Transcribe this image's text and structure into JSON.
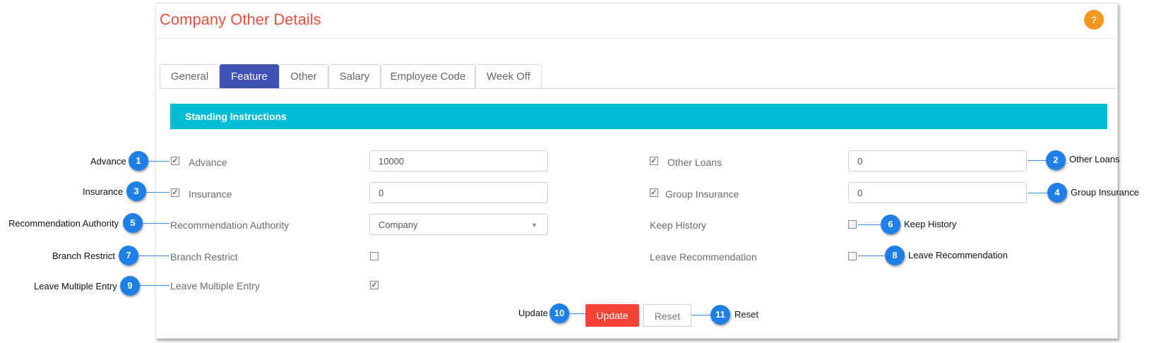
{
  "header": {
    "title": "Company Other Details",
    "help_label": "?"
  },
  "tabs": [
    "General",
    "Feature",
    "Other",
    "Salary",
    "Employee Code",
    "Week Off"
  ],
  "active_tab": "Feature",
  "section": {
    "title": "Standing Instructions"
  },
  "fields": {
    "advance": {
      "label": "Advance",
      "checked": true,
      "value": "10000"
    },
    "other_loans": {
      "label": "Other Loans",
      "checked": true,
      "value": "0"
    },
    "insurance": {
      "label": "Insurance",
      "checked": true,
      "value": "0"
    },
    "group_insurance": {
      "label": "Group Insurance",
      "checked": true,
      "value": "0"
    },
    "recommendation_authority": {
      "label": "Recommendation Authority",
      "value": "Company"
    },
    "keep_history": {
      "label": "Keep History",
      "checked": false
    },
    "branch_restrict": {
      "label": "Branch Restrict",
      "checked": false
    },
    "leave_recommendation": {
      "label": "Leave Recommendation",
      "checked": false
    },
    "leave_multiple_entry": {
      "label": "Leave Multiple Entry",
      "checked": true
    }
  },
  "actions": {
    "update": "Update",
    "reset": "Reset"
  },
  "callouts": [
    {
      "num": "1",
      "label": "Advance"
    },
    {
      "num": "2",
      "label": "Other Loans"
    },
    {
      "num": "3",
      "label": "Insurance"
    },
    {
      "num": "4",
      "label": "Group Insurance"
    },
    {
      "num": "5",
      "label": "Recommendation Authority"
    },
    {
      "num": "6",
      "label": "Keep History"
    },
    {
      "num": "7",
      "label": "Branch Restrict"
    },
    {
      "num": "8",
      "label": "Leave Recommendation"
    },
    {
      "num": "9",
      "label": "Leave Multiple Entry"
    },
    {
      "num": "10",
      "label": "Update"
    },
    {
      "num": "11",
      "label": "Reset"
    }
  ],
  "colors": {
    "title": "#e8503e",
    "active_tab": "#3f51b5",
    "section_bar": "#00bcd4",
    "update_button": "#f44336",
    "badge": "#1e7fe6",
    "help": "#f7941d"
  }
}
